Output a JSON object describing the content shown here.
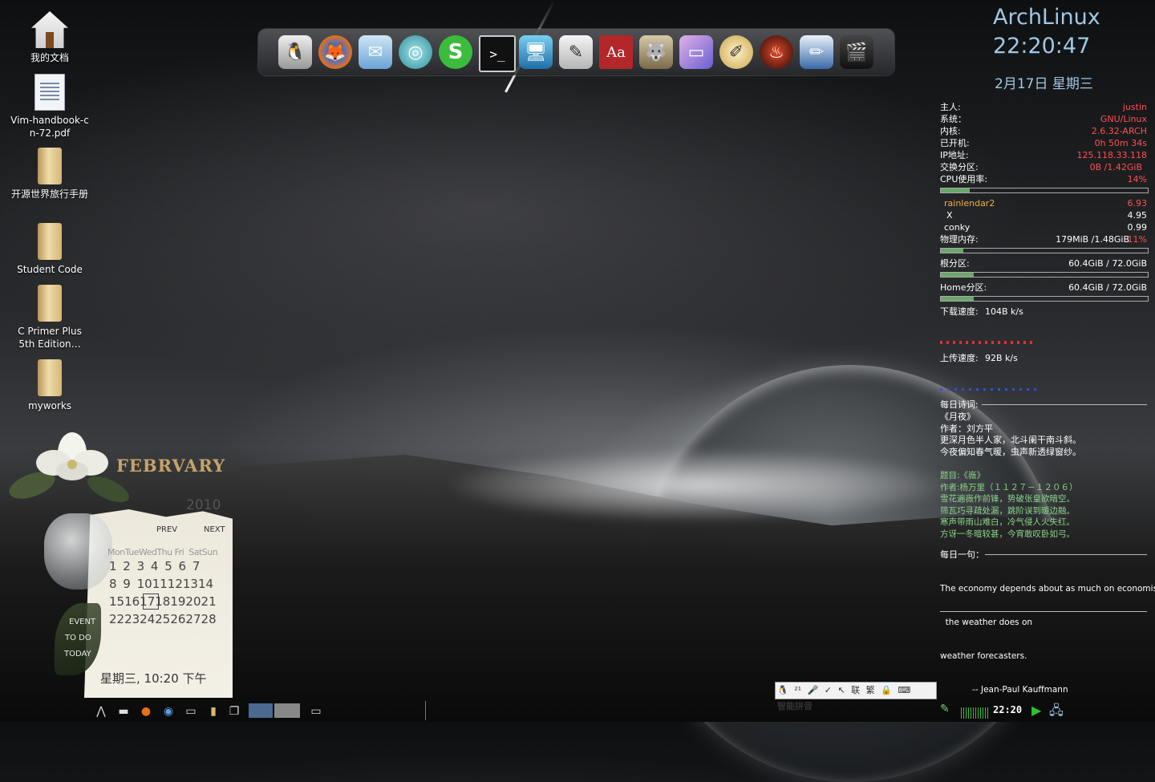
{
  "desktop_icons": [
    {
      "label": "我的文档",
      "icon": "home-folder-icon"
    },
    {
      "label": "Vim-handbook-cn-72.pdf",
      "icon": "pdf-file-icon"
    },
    {
      "label": "开源世界旅行手册",
      "icon": "folder-icon"
    },
    {
      "label": "Student Code",
      "icon": "folder-icon"
    },
    {
      "label": "C Primer Plus 5th Edition…",
      "icon": "folder-icon"
    },
    {
      "label": "myworks",
      "icon": "folder-icon"
    }
  ],
  "dock": [
    {
      "icon": "tux-icon",
      "glyph": "🐧"
    },
    {
      "icon": "firefox-icon",
      "glyph": "🦊"
    },
    {
      "icon": "mail-icon",
      "glyph": "✉"
    },
    {
      "icon": "chat-icon",
      "glyph": "◎"
    },
    {
      "icon": "skype-icon",
      "glyph": "S"
    },
    {
      "icon": "terminal-icon",
      "glyph": ">_"
    },
    {
      "icon": "monitor-icon",
      "glyph": "🖥"
    },
    {
      "icon": "writer-icon",
      "glyph": "✎"
    },
    {
      "icon": "dictionary-icon",
      "glyph": "Aa"
    },
    {
      "icon": "gimp-icon",
      "glyph": "🐺"
    },
    {
      "icon": "display-icon",
      "glyph": "▭"
    },
    {
      "icon": "brush-icon",
      "glyph": "✐"
    },
    {
      "icon": "flame-icon",
      "glyph": "♨"
    },
    {
      "icon": "draw-icon",
      "glyph": "✏"
    },
    {
      "icon": "video-icon",
      "glyph": "🎬"
    }
  ],
  "conky": {
    "distro": "ArchLinux",
    "time": "22:20:47",
    "date": "2月17日 星期三",
    "host_label": "主人:",
    "host": "justin",
    "os_label": "系统：",
    "os": "GNU/Linux",
    "kernel_label": "内核:",
    "kernel": "2.6.32-ARCH",
    "uptime_label": "已开机:",
    "uptime": "0h 50m 34s",
    "ip_label": "IP地址:",
    "ip": "125.118.33.118",
    "swap_label": "交换分区:",
    "swap": "0B     /1.42GiB",
    "cpu_label": "CPU使用率:",
    "cpu": "14%",
    "cpu_fraction": 0.14,
    "processes": [
      {
        "name": "rainlendar2",
        "value": "6.93"
      },
      {
        "name": "X",
        "value": "4.95"
      },
      {
        "name": "conky",
        "value": "0.99"
      }
    ],
    "mem_label": "物理内存:",
    "mem": "179MiB  /1.48GiB",
    "mem_pct": "11%",
    "mem_fraction": 0.11,
    "root_label": "根分区:",
    "root": "60.4GiB / 72.0GiB",
    "root_fraction": 0.16,
    "home_label": "Home分区:",
    "home": "60.4GiB / 72.0GiB",
    "home_fraction": 0.16,
    "down_label": "下载速度:",
    "down": "104B     k/s",
    "up_label": "上传速度:",
    "up": "92B      k/s",
    "poem_title_label": "每日诗词:",
    "poem1": [
      "《月夜》",
      "作者：刘方平",
      "更深月色半人家，北斗阑干南斗斜。",
      "今夜偏知春气暖，虫声新透绿窗纱。"
    ],
    "poem2": [
      "题目:《嶶》",
      "作者:杨万里（１１２７－１２０６）",
      "雪花遍嶶作前锋，势破张皇欲暗空。",
      "筛瓦巧寻疏处漏，跳阶误到暖边融。",
      "寒声带雨山难白，冷气侵人火失红。",
      "方讶一冬暄较甚，今宵敢叹卧如弓。"
    ],
    "quote_label": "每日一句：",
    "quote": [
      "The economy depends about as much on economist",
      "  the weather does on",
      "weather forecasters.",
      "            -- Jean-Paul Kauffmann"
    ]
  },
  "calendar": {
    "month": "FEBRVARY",
    "year": "2010",
    "prev": "PREV",
    "next": "NEXT",
    "days_header": "MonTueWedThu Fri  SatSun",
    "weeks": [
      "1 2 3 4 5 6 7",
      "8 9 1011121314",
      "15161718192021",
      "22232425262728"
    ],
    "today": "17",
    "tags": [
      "EVENT",
      "TO DO",
      "TODAY"
    ],
    "footer": "星期三, 10:20 下午"
  },
  "ime": {
    "items": [
      "🐧",
      "²¹",
      "🎤",
      "✓",
      "↖",
      "联",
      "繁",
      "🔒",
      "⌨"
    ],
    "name": "智能拼音"
  },
  "tray": {
    "clock": "22:20"
  },
  "taskbar": [
    {
      "icon": "arch-menu-icon",
      "glyph": "⋀"
    },
    {
      "icon": "terminal-icon",
      "glyph": "▬"
    },
    {
      "icon": "firefox-icon",
      "glyph": "●"
    },
    {
      "icon": "browser-icon",
      "glyph": "◉"
    },
    {
      "icon": "monitor-icon",
      "glyph": "▭"
    },
    {
      "icon": "folder-icon",
      "glyph": "▮"
    },
    {
      "icon": "windows-icon",
      "glyph": "❐"
    }
  ]
}
